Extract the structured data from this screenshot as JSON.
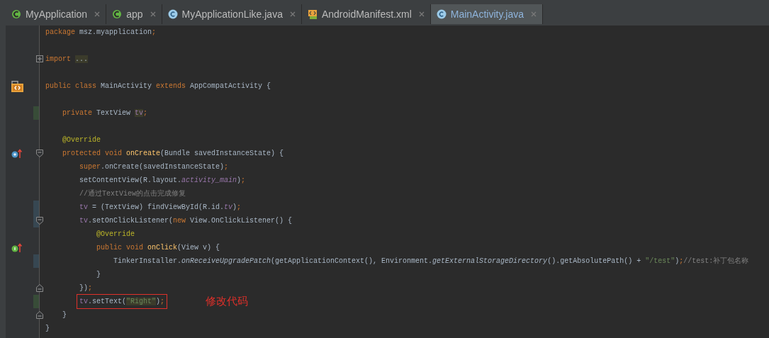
{
  "tabs": [
    {
      "label": "MyApplication",
      "kind": "module",
      "selected": false
    },
    {
      "label": "app",
      "kind": "module",
      "selected": false
    },
    {
      "label": "MyApplicationLike.java",
      "kind": "class",
      "selected": false
    },
    {
      "label": "AndroidManifest.xml",
      "kind": "manifest",
      "selected": false
    },
    {
      "label": "MainActivity.java",
      "kind": "class",
      "selected": true
    }
  ],
  "lines": [
    {
      "tokens": [
        {
          "t": "package ",
          "kind": "kw"
        },
        {
          "t": "msz.myapplication",
          "kind": "plain"
        },
        {
          "t": ";",
          "kind": "kw"
        }
      ]
    },
    {
      "space_before": true,
      "folded": true,
      "tokens": [
        {
          "t": "import ",
          "kind": "kw"
        },
        {
          "t": "...",
          "kind": "plain",
          "hl": true
        }
      ]
    },
    {
      "space_before": true,
      "kind": "class_decl",
      "tokens": [
        {
          "t": "public class ",
          "kind": "kw"
        },
        {
          "t": "MainActivity ",
          "kind": "plain"
        },
        {
          "t": "extends ",
          "kind": "kw"
        },
        {
          "t": "AppCompatActivity {",
          "kind": "plain"
        }
      ],
      "children": [
        {
          "space_before": true,
          "added": true,
          "tokens": [
            {
              "t": "private ",
              "kind": "kw"
            },
            {
              "t": "TextView ",
              "kind": "plain"
            },
            {
              "t": "tv",
              "kind": "field",
              "hl": true
            },
            {
              "t": ";",
              "kind": "kw"
            }
          ]
        },
        {
          "space_before": true,
          "tokens": [
            {
              "t": "@Override",
              "kind": "anno"
            }
          ]
        },
        {
          "kind": "override",
          "fold_start": true,
          "tokens": [
            {
              "t": "protected void ",
              "kind": "kw"
            },
            {
              "t": "onCreate",
              "kind": "decl"
            },
            {
              "t": "(Bundle savedInstanceState) {",
              "kind": "plain"
            }
          ],
          "children": [
            {
              "tokens": [
                {
                  "t": "super",
                  "kind": "kw"
                },
                {
                  "t": ".onCreate(savedInstanceState)",
                  "kind": "plain"
                },
                {
                  "t": ";",
                  "kind": "kw"
                }
              ]
            },
            {
              "tokens": [
                {
                  "t": "setContentView(R.layout.",
                  "kind": "plain"
                },
                {
                  "t": "activity_main",
                  "kind": "static_field"
                },
                {
                  "t": ")",
                  "kind": "plain"
                },
                {
                  "t": ";",
                  "kind": "kw"
                }
              ]
            },
            {
              "tokens": [
                {
                  "t": "//通过TextView的点击完成修复",
                  "kind": "comment"
                }
              ]
            },
            {
              "modified": true,
              "tokens": [
                {
                  "t": "tv",
                  "kind": "field"
                },
                {
                  "t": " = (TextView) findViewById(R.id.",
                  "kind": "plain"
                },
                {
                  "t": "tv",
                  "kind": "static_field"
                },
                {
                  "t": ")",
                  "kind": "plain"
                },
                {
                  "t": ";",
                  "kind": "kw"
                }
              ]
            },
            {
              "modified": true,
              "fold_start": true,
              "tokens": [
                {
                  "t": "tv",
                  "kind": "field"
                },
                {
                  "t": ".setOnClickListener(",
                  "kind": "plain"
                },
                {
                  "t": "new ",
                  "kind": "kw"
                },
                {
                  "t": "View.OnClickListener() {",
                  "kind": "plain"
                }
              ],
              "children": [
                {
                  "tokens": [
                    {
                      "t": "@Override",
                      "kind": "anno"
                    }
                  ]
                },
                {
                  "kind": "implement",
                  "tokens": [
                    {
                      "t": "public void ",
                      "kind": "kw"
                    },
                    {
                      "t": "onClick",
                      "kind": "decl"
                    },
                    {
                      "t": "(View v) {",
                      "kind": "plain"
                    }
                  ],
                  "children": [
                    {
                      "modified": true,
                      "tokens": [
                        {
                          "t": "TinkerInstaller.",
                          "kind": "plain"
                        },
                        {
                          "t": "onReceiveUpgradePatch",
                          "kind": "static"
                        },
                        {
                          "t": "(getApplicationContext(), Environment.",
                          "kind": "plain"
                        },
                        {
                          "t": "getExternalStorageDirectory",
                          "kind": "static"
                        },
                        {
                          "t": "().getAbsolutePath() + ",
                          "kind": "plain"
                        },
                        {
                          "t": "\"/test\"",
                          "kind": "string"
                        },
                        {
                          "t": ")",
                          "kind": "plain"
                        },
                        {
                          "t": ";",
                          "kind": "kw"
                        },
                        {
                          "t": "//test:补丁包名称",
                          "kind": "comment"
                        }
                      ]
                    }
                  ]
                },
                {
                  "tokens": [
                    {
                      "t": "}",
                      "kind": "plain"
                    }
                  ]
                }
              ]
            },
            {
              "fold_end": true,
              "tokens": [
                {
                  "t": "})",
                  "kind": "plain"
                },
                {
                  "t": ";",
                  "kind": "kw"
                }
              ]
            },
            {
              "added": true,
              "boxed": true,
              "note": "修改代码",
              "tokens": [
                {
                  "t": "tv",
                  "kind": "field"
                },
                {
                  "t": ".setText(",
                  "kind": "plain"
                },
                {
                  "t": "\"Right\"",
                  "kind": "string",
                  "hl": true
                },
                {
                  "t": ")",
                  "kind": "plain"
                },
                {
                  "t": ";",
                  "kind": "kw"
                }
              ]
            }
          ]
        },
        {
          "fold_end": true,
          "tokens": [
            {
              "t": "}",
              "kind": "plain"
            }
          ]
        }
      ]
    },
    {
      "tokens": [
        {
          "t": "}",
          "kind": "plain"
        }
      ]
    }
  ]
}
